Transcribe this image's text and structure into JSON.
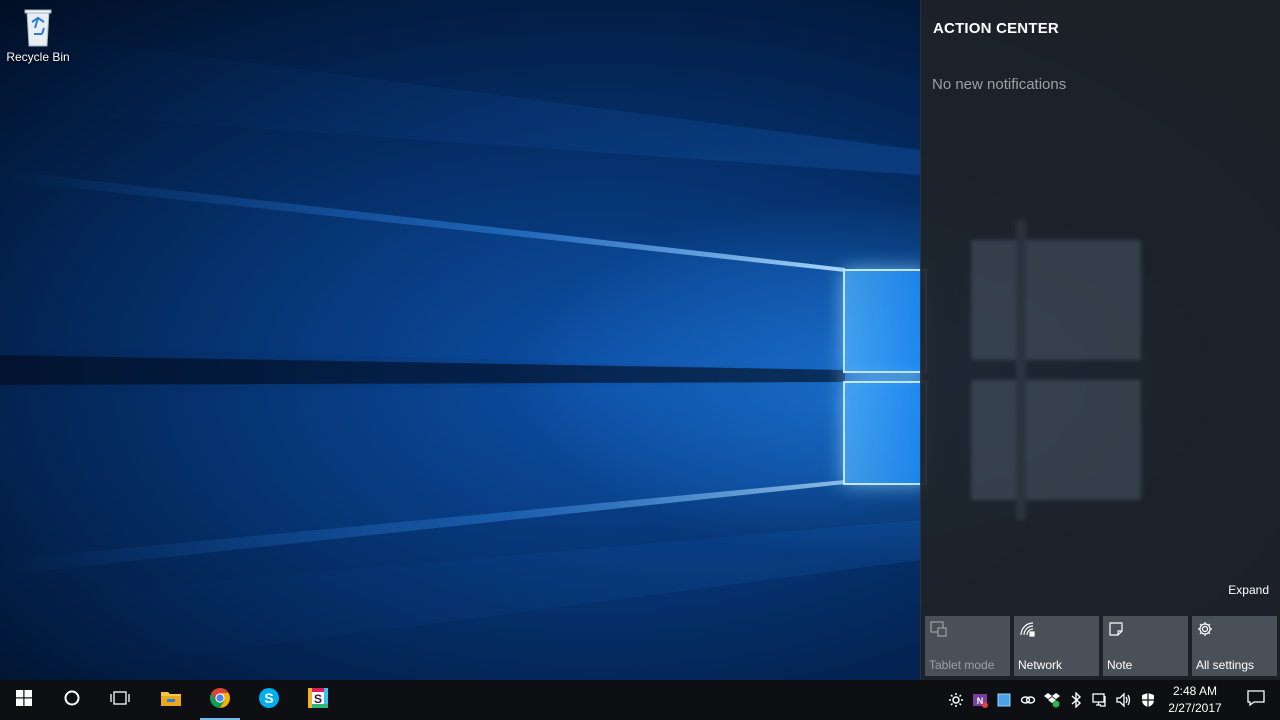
{
  "desktop": {
    "icons": [
      {
        "label": "Recycle Bin",
        "icon": "recycle-bin-icon"
      }
    ]
  },
  "action_center": {
    "title": "ACTION CENTER",
    "empty_message": "No new notifications",
    "expand_label": "Expand",
    "quick_actions": [
      {
        "label": "Tablet mode",
        "icon": "tablet-mode-icon",
        "enabled": false
      },
      {
        "label": "Network",
        "icon": "network-icon",
        "enabled": true
      },
      {
        "label": "Note",
        "icon": "note-icon",
        "enabled": true
      },
      {
        "label": "All settings",
        "icon": "settings-gear-icon",
        "enabled": true
      }
    ]
  },
  "taskbar": {
    "pinned": [
      {
        "name": "start",
        "icon": "windows-logo-icon"
      },
      {
        "name": "cortana",
        "icon": "cortana-circle-icon"
      },
      {
        "name": "task-view",
        "icon": "task-view-icon"
      },
      {
        "name": "file-explorer",
        "icon": "folder-icon"
      },
      {
        "name": "chrome",
        "icon": "chrome-icon",
        "active": true
      },
      {
        "name": "skype",
        "icon": "skype-icon"
      },
      {
        "name": "slack",
        "icon": "slack-icon"
      }
    ],
    "tray": [
      "brightness-icon",
      "onenote-icon",
      "blue-square-icon",
      "link-icon",
      "dropbox-icon",
      "bluetooth-icon",
      "network-monitor-icon",
      "volume-icon",
      "shield-icon"
    ],
    "clock": {
      "time": "2:48 AM",
      "date": "2/27/2017"
    }
  },
  "colors": {
    "accent": "#76b9ed",
    "action_center_bg": "#1e2228",
    "tile_bg": "#4a5057",
    "taskbar_bg": "#0d0f12"
  }
}
